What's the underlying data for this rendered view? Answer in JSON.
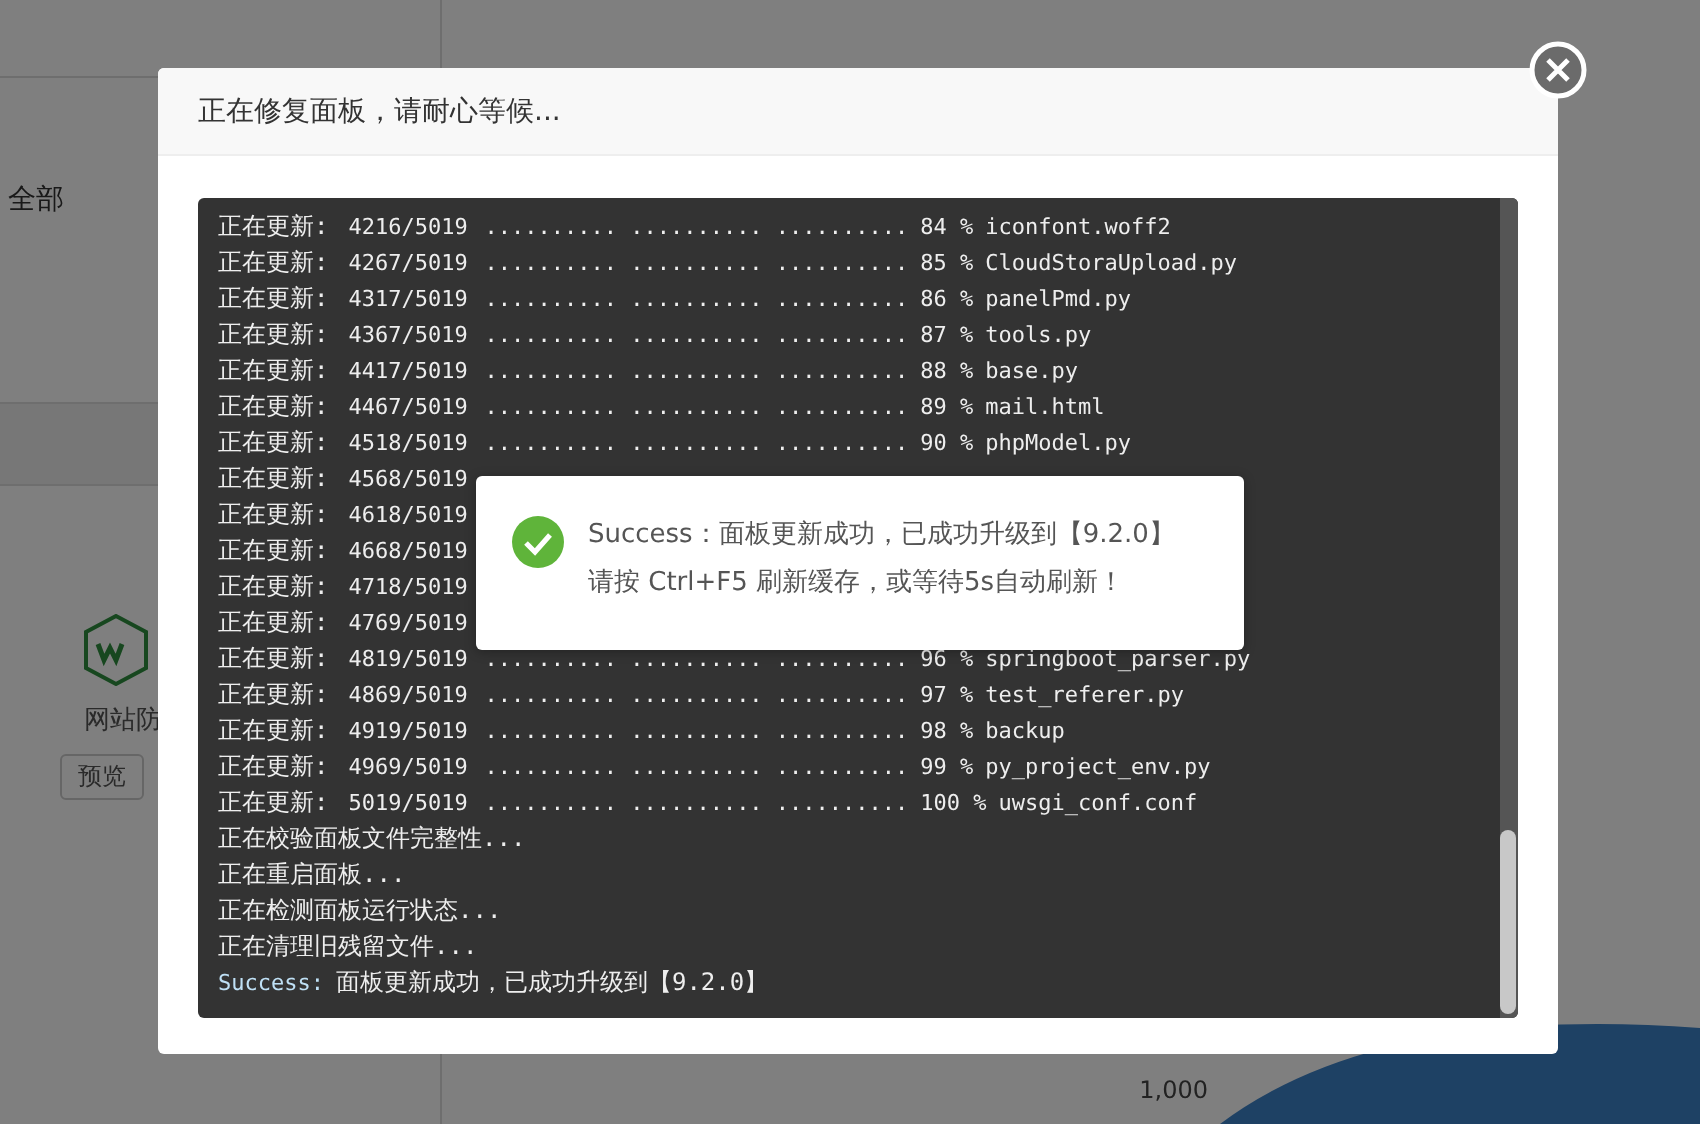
{
  "background": {
    "filter_label": "全部",
    "card_title": "网站防",
    "preview_button": "预览",
    "chart_axis_label": "1,000"
  },
  "dialog": {
    "title": "正在修复面板，请耐心等候...",
    "log": [
      {
        "kind": "progress",
        "label": "正在更新:",
        "count": "4216/5019",
        "dots": ".......... .......... ..........",
        "percent": "84 %",
        "file": "iconfont.woff2"
      },
      {
        "kind": "progress",
        "label": "正在更新:",
        "count": "4267/5019",
        "dots": ".......... .......... ..........",
        "percent": "85 %",
        "file": "CloudStoraUpload.py"
      },
      {
        "kind": "progress",
        "label": "正在更新:",
        "count": "4317/5019",
        "dots": ".......... .......... ..........",
        "percent": "86 %",
        "file": "panelPmd.py"
      },
      {
        "kind": "progress",
        "label": "正在更新:",
        "count": "4367/5019",
        "dots": ".......... .......... ..........",
        "percent": "87 %",
        "file": "tools.py"
      },
      {
        "kind": "progress",
        "label": "正在更新:",
        "count": "4417/5019",
        "dots": ".......... .......... ..........",
        "percent": "88 %",
        "file": "base.py"
      },
      {
        "kind": "progress",
        "label": "正在更新:",
        "count": "4467/5019",
        "dots": ".......... .......... ..........",
        "percent": "89 %",
        "file": "mail.html"
      },
      {
        "kind": "progress",
        "label": "正在更新:",
        "count": "4518/5019",
        "dots": ".......... .......... ..........",
        "percent": "90 %",
        "file": "phpModel.py"
      },
      {
        "kind": "progress",
        "label": "正在更新:",
        "count": "4568/5019"
      },
      {
        "kind": "progress",
        "label": "正在更新:",
        "count": "4618/5019"
      },
      {
        "kind": "progress",
        "label": "正在更新:",
        "count": "4668/5019"
      },
      {
        "kind": "progress",
        "label": "正在更新:",
        "count": "4718/5019"
      },
      {
        "kind": "progress",
        "label": "正在更新:",
        "count": "4769/5019"
      },
      {
        "kind": "progress",
        "label": "正在更新:",
        "count": "4819/5019",
        "dots": ".......... .......... ..........",
        "percent": "96 %",
        "file": "springboot_parser.py"
      },
      {
        "kind": "progress",
        "label": "正在更新:",
        "count": "4869/5019",
        "dots": ".......... .......... ..........",
        "percent": "97 %",
        "file": "test_referer.py"
      },
      {
        "kind": "progress",
        "label": "正在更新:",
        "count": "4919/5019",
        "dots": ".......... .......... ..........",
        "percent": "98 %",
        "file": "backup"
      },
      {
        "kind": "progress",
        "label": "正在更新:",
        "count": "4969/5019",
        "dots": ".......... .......... ..........",
        "percent": "99 %",
        "file": "py_project_env.py"
      },
      {
        "kind": "progress",
        "label": "正在更新:",
        "count": "5019/5019",
        "dots": ".......... .......... ..........",
        "percent": "100 %",
        "file": "uwsgi_conf.conf"
      },
      {
        "kind": "status",
        "text": "正在校验面板文件完整性..."
      },
      {
        "kind": "status",
        "text": "正在重启面板..."
      },
      {
        "kind": "status",
        "text": "正在检测面板运行状态..."
      },
      {
        "kind": "status",
        "text": "正在清理旧残留文件..."
      },
      {
        "kind": "success",
        "label": "Success:",
        "text": "面板更新成功，已成功升级到【9.2.0】"
      }
    ]
  },
  "toast": {
    "line_1": "Success：面板更新成功，已成功升级到【9.2.0】",
    "line_2": "请按 Ctrl+F5 刷新缓存，或等待5s自动刷新！"
  }
}
